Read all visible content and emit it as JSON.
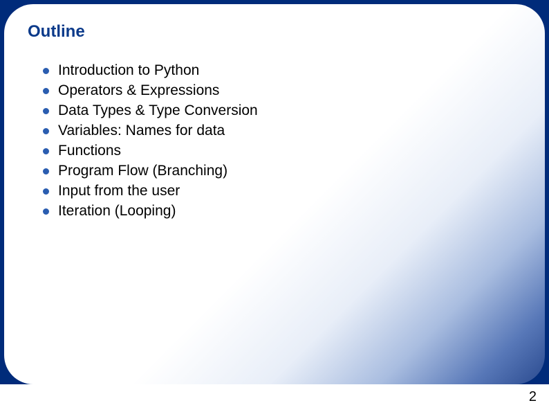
{
  "slide": {
    "title": "Outline",
    "items": [
      "Introduction to Python",
      "Operators & Expressions",
      "Data Types & Type Conversion",
      "Variables: Names for data",
      "Functions",
      "Program Flow (Branching)",
      "Input from the user",
      "Iteration (Looping)"
    ],
    "page_number": "2"
  }
}
